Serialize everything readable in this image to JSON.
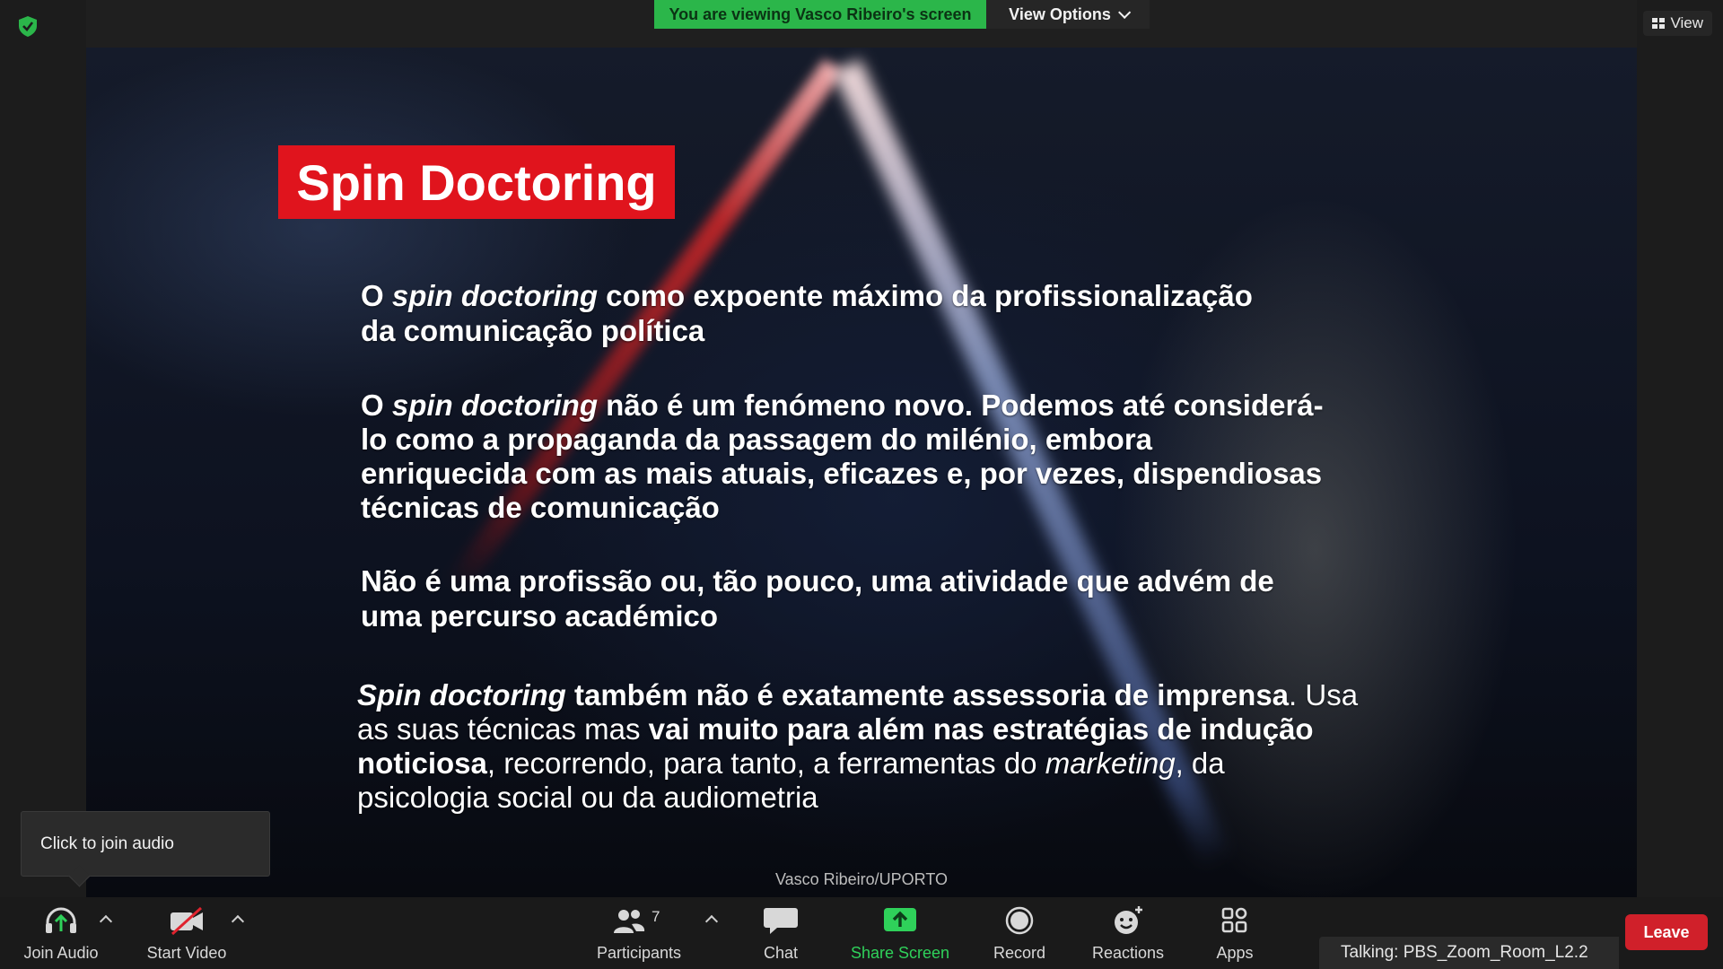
{
  "header": {
    "viewing_banner": "You are viewing Vasco Ribeiro's screen",
    "view_options_label": "View Options",
    "view_label": "View"
  },
  "slide": {
    "title": "Spin Doctoring",
    "p1": {
      "a": "O ",
      "b": "spin doctoring",
      "c": " como expoente máximo da profissionalização",
      "d": "da comunicação política"
    },
    "p2": {
      "a": "O ",
      "b": "spin doctoring",
      "c": " não é um fenómeno novo. Podemos até considerá-",
      "d": "lo como a propaganda da passagem do milénio, embora",
      "e": "enriquecida com as mais atuais, eficazes e, por vezes, dispendiosas",
      "f": "técnicas de comunicação"
    },
    "p3": {
      "a": "Não é uma profissão ou, tão pouco, uma atividade que advém de",
      "b": "uma percurso académico"
    },
    "p4": {
      "a": "Spin doctoring",
      "b": " também não é exatamente assessoria de imprensa",
      "c": ". Usa",
      "d": "as suas técnicas mas ",
      "e": "vai muito para além nas estratégias de indução",
      "f": "noticiosa",
      "g": ", recorrendo, para tanto, a ferramentas do ",
      "h": "marketing",
      "i": ", da",
      "j": "psicologia social ou da audiometria"
    },
    "credit": "Vasco Ribeiro/UPORTO"
  },
  "tooltip": {
    "join_audio": "Click to join audio"
  },
  "toolbar": {
    "join_audio": "Join Audio",
    "start_video": "Start Video",
    "participants": "Participants",
    "participants_count": "7",
    "chat": "Chat",
    "share_screen": "Share Screen",
    "record": "Record",
    "reactions": "Reactions",
    "apps": "Apps",
    "leave": "Leave"
  },
  "status": {
    "talking": "Talking: PBS_Zoom_Room_L2.2"
  },
  "colors": {
    "banner_green": "#2bb64a",
    "share_green": "#2fd15a",
    "leave_red": "#d0202a",
    "title_red": "#e0141d"
  },
  "icons": [
    "shield-check-icon",
    "grid-view-icon",
    "headphones-icon",
    "video-off-icon",
    "participants-icon",
    "chat-icon",
    "share-screen-icon",
    "record-icon",
    "reactions-icon",
    "apps-icon"
  ]
}
